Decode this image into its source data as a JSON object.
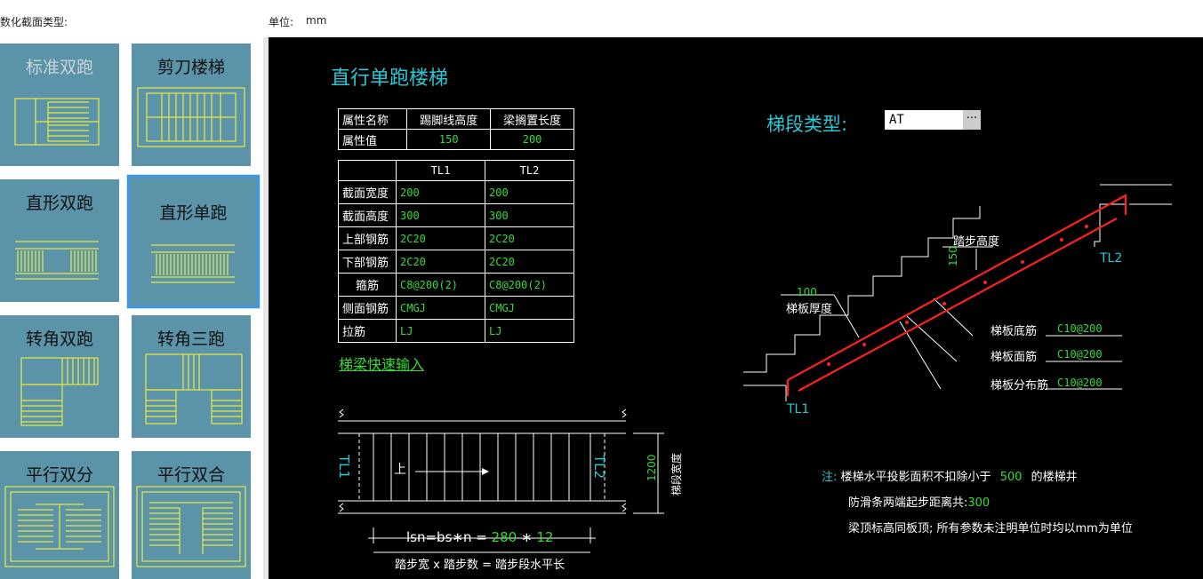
{
  "header": {
    "section_type_label": "数化截面类型:",
    "unit_label": "单位:",
    "unit_value": "mm"
  },
  "sidebar": {
    "items": [
      {
        "label": "标准双跑"
      },
      {
        "label": "剪刀楼梯"
      },
      {
        "label": "直形双跑"
      },
      {
        "label": "直形单跑",
        "selected": true
      },
      {
        "label": "转角双跑"
      },
      {
        "label": "转角三跑"
      },
      {
        "label": "平行双分"
      },
      {
        "label": "平行双合"
      }
    ]
  },
  "canvas": {
    "title": "直行单跑楼梯",
    "segment_type_label": "梯段类型:",
    "segment_type_value": "AT",
    "segment_type_button": "···",
    "attr_table": {
      "headers": [
        "属性名称",
        "踢脚线高度",
        "梁搁置长度"
      ],
      "row_label": "属性值",
      "values": [
        "150",
        "200"
      ]
    },
    "beam_table": {
      "columns": [
        "TL1",
        "TL2"
      ],
      "rows": [
        {
          "label": "截面宽度",
          "tl1": "200",
          "tl2": "200"
        },
        {
          "label": "截面高度",
          "tl1": "300",
          "tl2": "300"
        },
        {
          "label": "上部钢筋",
          "tl1": "2C20",
          "tl2": "2C20"
        },
        {
          "label": "下部钢筋",
          "tl1": "2C20",
          "tl2": "2C20"
        },
        {
          "label": "箍筋",
          "tl1": "C8@200(2)",
          "tl2": "C8@200(2)"
        },
        {
          "label": "侧面钢筋",
          "tl1": "CMGJ",
          "tl2": "CMGJ"
        },
        {
          "label": "拉筋",
          "tl1": "LJ",
          "tl2": "LJ"
        }
      ]
    },
    "quick_input_link": "梯梁快速输入",
    "plan": {
      "tl1": "TL1",
      "tl2": "TL2",
      "up": "上",
      "width_value": "1200",
      "width_label": "梯段宽度",
      "formula_prefix": "lsn=bs∗n = ",
      "bs": "280",
      "op": " ∗ ",
      "n": "12",
      "caption": "踏步宽 x 踏步数 = 踏步段水平长"
    },
    "section": {
      "step_height_label": "踏步高度",
      "step_height_value": "150",
      "slab_thickness_value": "100",
      "slab_thickness_label": "梯板厚度",
      "tl1": "TL1",
      "tl2": "TL2",
      "rebars": [
        {
          "label": "梯板底筋",
          "value": "C10@200"
        },
        {
          "label": "梯板面筋",
          "value": "C10@200"
        },
        {
          "label": "梯板分布筋",
          "value": "C10@200"
        }
      ]
    },
    "notes": {
      "prefix": "注:",
      "line1_a": "楼梯水平投影面积不扣除小于",
      "line1_value": "500",
      "line1_b": "的楼梯井",
      "line2_a": "防滑条两端起步距离共:",
      "line2_value": "300",
      "line3": "梁顶标高同板顶; 所有参数未注明单位时均以mm为单位"
    }
  }
}
